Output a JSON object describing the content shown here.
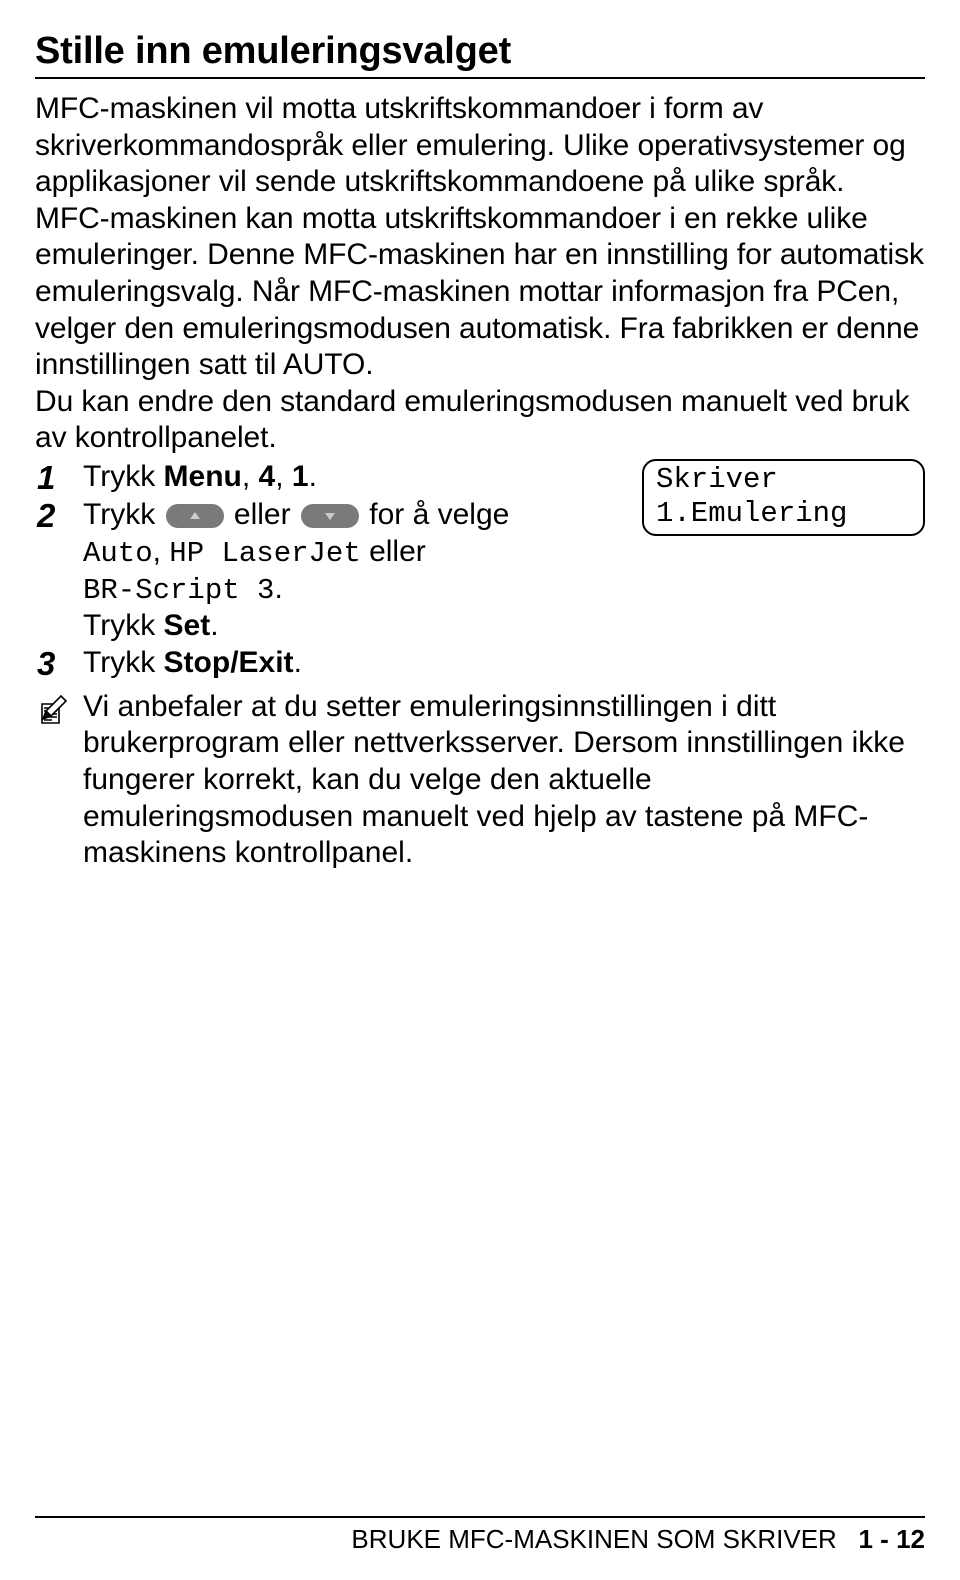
{
  "heading": "Stille inn emuleringsvalget",
  "para1": "MFC-maskinen vil motta utskriftskommandoer i form av skriverkommandospråk eller emulering. Ulike operativsystemer og applikasjoner vil sende utskriftskommandoene på ulike språk. MFC-maskinen kan motta utskriftskommandoer i en rekke ulike emuleringer. Denne MFC-maskinen har en innstilling for automatisk emuleringsvalg. Når MFC-maskinen mottar informasjon fra PCen, velger den emuleringsmodusen automatisk. Fra fabrikken er denne innstillingen satt til AUTO.",
  "para2": "Du kan endre den standard emuleringsmodusen manuelt ved bruk av kontrollpanelet.",
  "steps": {
    "s1": {
      "num": "1",
      "prefix": "Trykk ",
      "menu": "Menu",
      "comma1": ", ",
      "k1": "4",
      "comma2": ", ",
      "k2": "1",
      "dot": "."
    },
    "s2": {
      "num": "2",
      "a": "Trykk ",
      "mid": " eller ",
      "b": " for å velge ",
      "opt1": "Auto",
      "c": ", ",
      "opt2": "HP LaserJet",
      "d": " eller ",
      "opt3": "BR-Script 3",
      "e": ".",
      "press": "Trykk ",
      "set": "Set",
      "f": "."
    },
    "s3": {
      "num": "3",
      "press": "Trykk ",
      "stop": "Stop/Exit",
      "dot": "."
    }
  },
  "display": {
    "line1": "Skriver",
    "line2": "1.Emulering"
  },
  "note": "Vi anbefaler at du setter emuleringsinnstillingen i ditt brukerprogram eller nettverksserver. Dersom innstillingen ikke fungerer korrekt, kan du velge den aktuelle emuleringsmodusen manuelt ved hjelp av tastene på MFC-maskinens kontrollpanel.",
  "footer": {
    "title": "BRUKE MFC-MASKINEN SOM SKRIVER",
    "page": "1 - 12"
  }
}
